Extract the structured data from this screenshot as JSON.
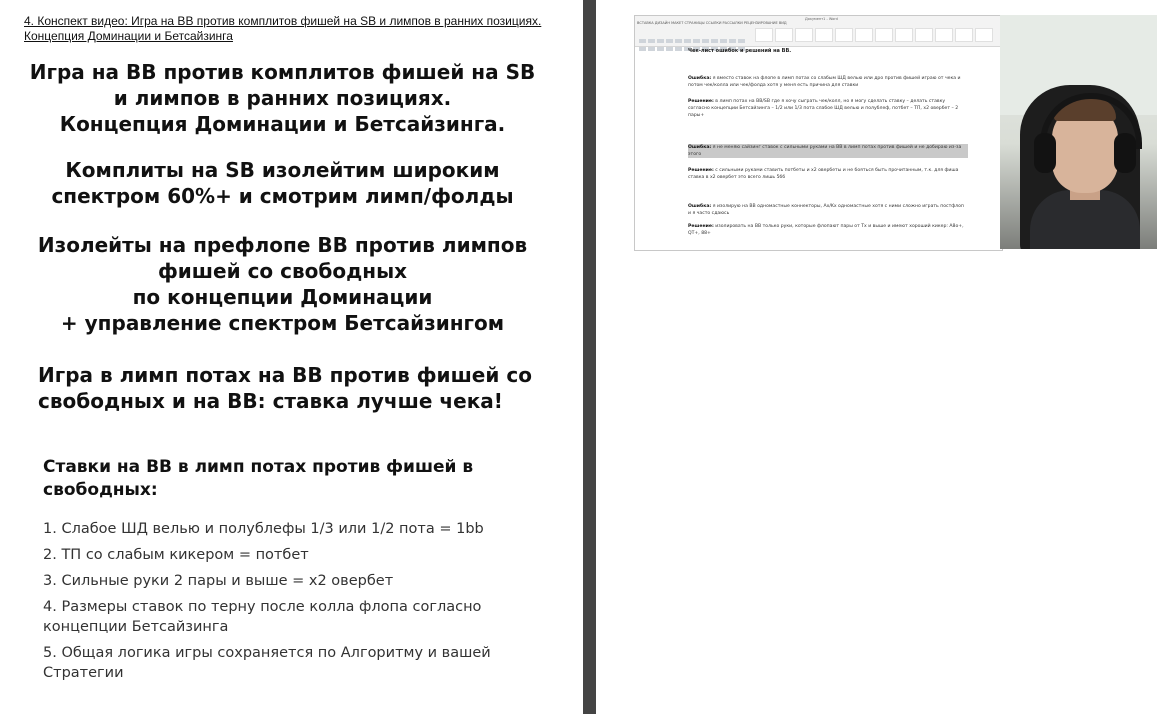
{
  "slide": {
    "caption": "4. Конспект видео: Игра на BB против комплитов фишей на SB и лимпов в ранних позициях. Концепция Доминации и Бетсайзинга",
    "heading1": "Игра на BB против комплитов фишей на SB\nи лимпов в ранних позициях.\nКонцепция Доминации и Бетсайзинга.",
    "heading2": "Комплиты на SB изолейтим широким\nспектром 60%+ и смотрим лимп/фолды",
    "heading3": "Изолейты на префлопе BB против лимпов\nфишей со свободных\nпо концепции Доминации\n+  управление спектром Бетсайзингом",
    "heading4": "Игра в лимп потах на BB против фишей со\nсвободных и на BB: ставка лучше чека!",
    "stakes_title": "Ставки на BB в лимп потах против фишей в свободных:",
    "stakes_items": [
      "1. Слабое ШД велью и полублефы 1/3 или 1/2 пота = 1bb",
      "2. ТП со слабым кикером = потбет",
      "3. Сильные руки 2 пары и выше = x2 овербет",
      "4. Размеры ставок по терну после колла флопа согласно концепции Бетсайзинга",
      "5. Общая логика игры сохраняется по Алгоритму и вашей Стратегии"
    ]
  },
  "document": {
    "window_title": "Документ1 - Word",
    "ribbon_tabs": "ВСТАВКА   ДИЗАЙН   МАКЕТ СТРАНИЦЫ   ССЫЛКИ   РАССЫЛКИ   РЕЦЕНЗИРОВАНИЕ   ВИД",
    "heading": "Чек-лист ошибок и решений на BB.",
    "p1_label": "Ошибка:",
    "p1_text": " я вместо ставок на флопе в лимп потах со слабым ШД велью или дро против фишей играю от чека и потом чек/колла или чек/фолда хотя у меня есть причина для ставки",
    "p2_label": "Решение:",
    "p2_text": " в лимп потах на BB/SB где я хочу сыграть чек/колл, но я могу сделать ставку – делать ставку согласно концепции Бетсайзинга – 1/2 или 1/3 пота слабое ШД велью и полублеф, потбет – ТП, x2 овербет – 2 пары+",
    "p3_label": "Ошибка:",
    "p3_text": " я не меняю сайзинг ставок с сильными руками на BB в лимп потах против фишей и не добираю из-за этого",
    "p4_label": "Решение:",
    "p4_text": " с сильными руками ставить потбеты и x2 овербеты и не бояться быть прочитанным, т.к. для фиша ставка в x2 овербет это всего лишь 5бб",
    "p5_label": "Ошибка:",
    "p5_text": " я изолирую на BB одномастные коннекторы, Ax/Kx одномастные хотя с ними сложно играть постфлоп и я часто сдаюсь",
    "p6_label": "Решение:",
    "p6_text": " изолировать на BB только руки, которые флопают пары от Tx и выше и имеют хороший кикер: A8o+, QT+, 88+"
  }
}
